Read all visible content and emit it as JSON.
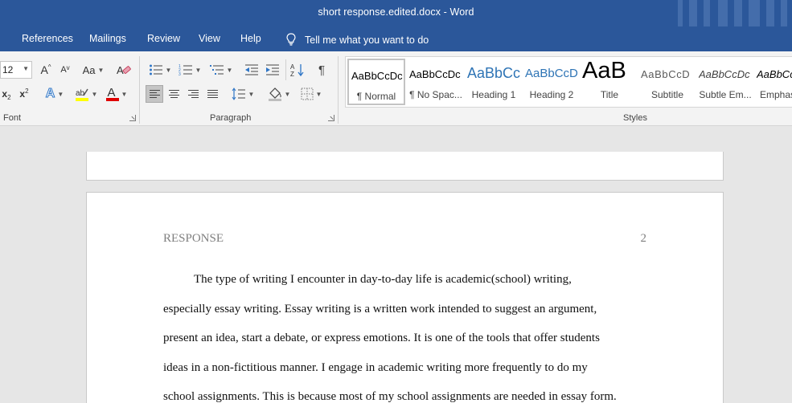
{
  "window": {
    "title": "short response.edited.docx  -  Word"
  },
  "tabs": [
    "References",
    "Mailings",
    "Review",
    "View",
    "Help"
  ],
  "tell_me": "Tell me what you want to do",
  "ribbon": {
    "font": {
      "label": "Font",
      "size_value": "12",
      "grow_label": "A",
      "shrink_label": "A",
      "case_label": "Aa",
      "subscript_label": "x",
      "superscript_label": "x",
      "text_effects_label": "A",
      "font_color_label": "A",
      "highlight_color": "#ffff00",
      "font_color": "#e00000"
    },
    "paragraph": {
      "label": "Paragraph"
    },
    "styles": {
      "label": "Styles",
      "items": [
        {
          "sample": "AaBbCcDc",
          "name": "¶ Normal"
        },
        {
          "sample": "AaBbCcDc",
          "name": "¶ No Spac..."
        },
        {
          "sample": "AaBbCc",
          "name": "Heading 1"
        },
        {
          "sample": "AaBbCcD",
          "name": "Heading 2"
        },
        {
          "sample": "AaB",
          "name": "Title"
        },
        {
          "sample": "AaBbCcD",
          "name": "Subtitle"
        },
        {
          "sample": "AaBbCcDc",
          "name": "Subtle Em..."
        },
        {
          "sample": "AaBbCcDc",
          "name": "Emphas"
        }
      ]
    }
  },
  "document": {
    "header_left": "RESPONSE",
    "header_right": "2",
    "lines": [
      "The type of writing I encounter in day-to-day life is academic(school) writing,",
      "especially essay writing. Essay writing is a written work intended to suggest an argument,",
      "present an idea, start a debate, or express emotions. It is one of the tools that offer students",
      "ideas in a non-fictitious manner. I engage in academic writing more frequently to do my",
      "school assignments. This is because most of my school assignments are needed in essay form."
    ]
  },
  "colors": {
    "accent": "#2b579a",
    "ribbon_bg": "#f3f3f3",
    "canvas_bg": "#e6e6e6"
  }
}
